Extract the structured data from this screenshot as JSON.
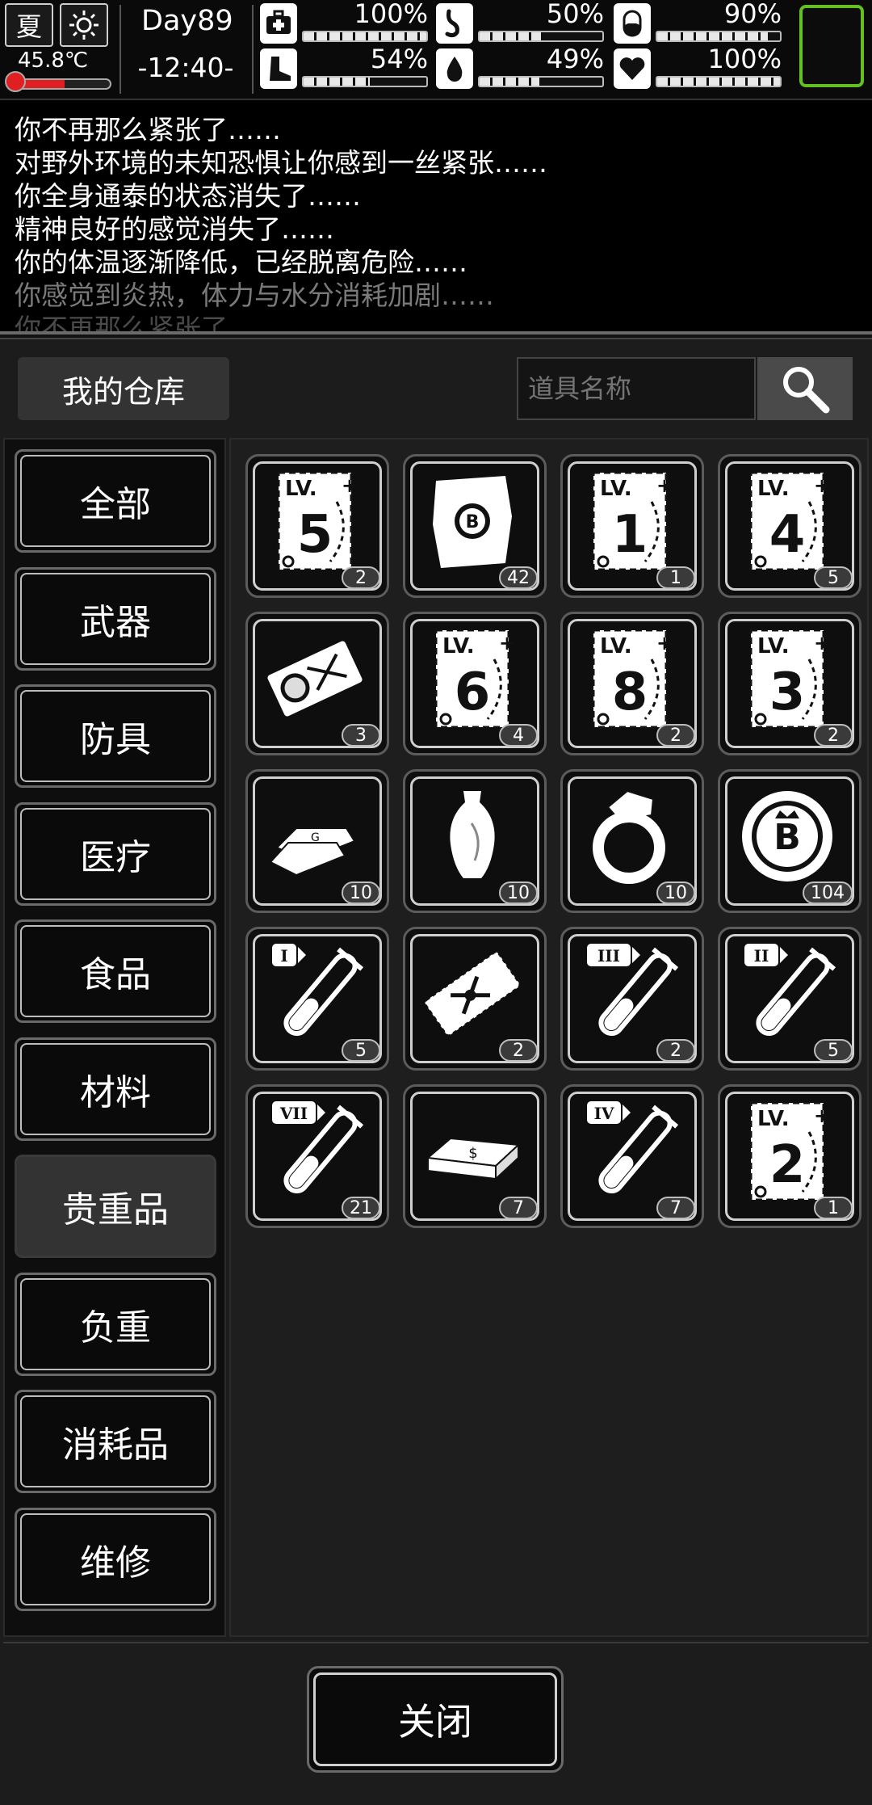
{
  "status": {
    "season": "夏",
    "weather_icon": "sun-icon",
    "temperature": "45.8℃",
    "temperature_level": 0.55,
    "day": "Day89",
    "time": "-12:40-",
    "stats": [
      {
        "name": "health",
        "icon": "medkit-icon",
        "value": "100%",
        "level": 1.0
      },
      {
        "name": "hunger",
        "icon": "stomach-icon",
        "value": "50%",
        "level": 0.5
      },
      {
        "name": "mood",
        "icon": "pill-icon",
        "value": "90%",
        "level": 0.9
      },
      {
        "name": "stamina",
        "icon": "boot-icon",
        "value": "54%",
        "level": 0.54
      },
      {
        "name": "thirst",
        "icon": "water-drop-icon",
        "value": "49%",
        "level": 0.49
      },
      {
        "name": "heart",
        "icon": "heart-icon",
        "value": "100%",
        "level": 1.0
      }
    ]
  },
  "log": {
    "lines": [
      "你不再那么紧张了……",
      "对野外环境的未知恐惧让你感到一丝紧张……",
      "你全身通泰的状态消失了……",
      "精神良好的感觉消失了……",
      "你的体温逐渐降低，已经脱离危险……",
      "你感觉到炎热，体力与水分消耗加剧……",
      "你不再那么紧张了……"
    ]
  },
  "warehouse": {
    "title": "我的仓库",
    "search_placeholder": "道具名称",
    "categories": [
      "全部",
      "武器",
      "防具",
      "医疗",
      "食品",
      "材料",
      "贵重品",
      "负重",
      "消耗品",
      "维修"
    ],
    "active_category": "贵重品",
    "items": [
      {
        "icon": "skill-book-lv5-icon",
        "kind": "book",
        "label": "5",
        "count": "2"
      },
      {
        "icon": "treasure-map-icon",
        "kind": "map",
        "label": "",
        "count": "42"
      },
      {
        "icon": "skill-book-lv1-icon",
        "kind": "book",
        "label": "1",
        "count": "1"
      },
      {
        "icon": "skill-book-lv4-icon",
        "kind": "book",
        "label": "4",
        "count": "5"
      },
      {
        "icon": "portrait-ticket-icon",
        "kind": "ticket",
        "label": "",
        "count": "3"
      },
      {
        "icon": "skill-book-lv6-icon",
        "kind": "book",
        "label": "6",
        "count": "4"
      },
      {
        "icon": "skill-book-lv8-icon",
        "kind": "book",
        "label": "8",
        "count": "2"
      },
      {
        "icon": "skill-book-lv3-icon",
        "kind": "book",
        "label": "3",
        "count": "2"
      },
      {
        "icon": "gold-bar-icon",
        "kind": "gold",
        "label": "",
        "count": "10"
      },
      {
        "icon": "vase-icon",
        "kind": "vase",
        "label": "",
        "count": "10"
      },
      {
        "icon": "diamond-ring-icon",
        "kind": "ring",
        "label": "",
        "count": "10"
      },
      {
        "icon": "bitcoin-coin-icon",
        "kind": "coin",
        "label": "",
        "count": "104"
      },
      {
        "icon": "test-tube-i-icon",
        "kind": "tube",
        "label": "I",
        "count": "5"
      },
      {
        "icon": "key-ticket-icon",
        "kind": "ticket2",
        "label": "",
        "count": "2"
      },
      {
        "icon": "test-tube-iii-icon",
        "kind": "tube",
        "label": "III",
        "count": "2"
      },
      {
        "icon": "test-tube-ii-icon",
        "kind": "tube",
        "label": "II",
        "count": "5"
      },
      {
        "icon": "test-tube-vii-icon",
        "kind": "tube",
        "label": "VII",
        "count": "21"
      },
      {
        "icon": "cash-stack-icon",
        "kind": "cash",
        "label": "",
        "count": "7"
      },
      {
        "icon": "test-tube-iv-icon",
        "kind": "tube",
        "label": "IV",
        "count": "7"
      },
      {
        "icon": "skill-book-lv2-icon",
        "kind": "book",
        "label": "2",
        "count": "1"
      }
    ],
    "book_prefix": "LV.",
    "close_label": "关闭"
  },
  "colors": {
    "selected_slot": "#63c01f",
    "temp_fill": "#e02020"
  }
}
